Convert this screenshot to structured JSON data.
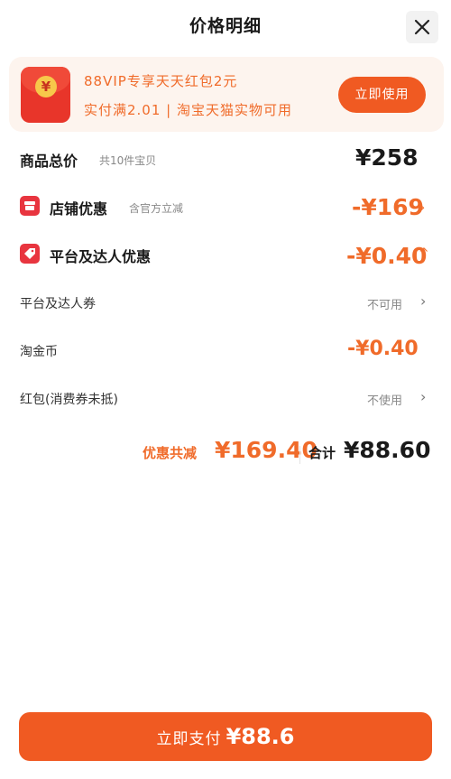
{
  "header": {
    "title": "价格明细"
  },
  "promo": {
    "line1": "88VIP专享天天红包2元",
    "line2": "实付满2.01 | 淘宝天猫实物可用",
    "button": "立即使用"
  },
  "total": {
    "label": "商品总价",
    "sub": "共10件宝贝",
    "value": "¥258"
  },
  "store": {
    "label": "店铺优惠",
    "sub": "含官方立减",
    "value": "-¥169"
  },
  "platform": {
    "label": "平台及达人优惠",
    "value": "-¥0.40"
  },
  "platform_coupon": {
    "label": "平台及达人券",
    "status": "不可用"
  },
  "tao_coin": {
    "label": "淘金币",
    "value": "-¥0.40"
  },
  "red_packet": {
    "label": "红包(消费券未抵)",
    "status": "不使用"
  },
  "summary": {
    "discount_label": "优惠共减",
    "discount_value": "¥169.40",
    "total_label": "合计",
    "total_value": "¥88.60"
  },
  "pay": {
    "label": "立即支付",
    "amount": "¥88.6"
  },
  "colors": {
    "accent": "#f05a22",
    "accent_text": "#f06b2a",
    "badge_red": "#e8353f"
  }
}
